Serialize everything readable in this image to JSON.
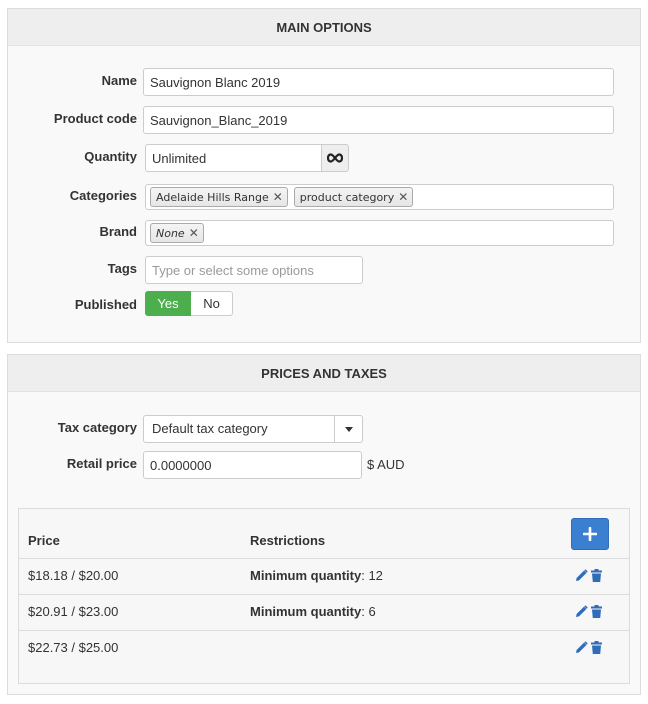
{
  "main_options": {
    "title": "MAIN OPTIONS",
    "name": {
      "label": "Name",
      "value": "Sauvignon Blanc 2019"
    },
    "product_code": {
      "label": "Product code",
      "value": "Sauvignon_Blanc_2019"
    },
    "quantity": {
      "label": "Quantity",
      "value": "Unlimited",
      "addon_icon": "infinity-icon"
    },
    "categories": {
      "label": "Categories",
      "items": [
        "Adelaide Hills Range",
        "product category"
      ]
    },
    "brand": {
      "label": "Brand",
      "value": "None"
    },
    "tags": {
      "label": "Tags",
      "placeholder": "Type or select some options"
    },
    "published": {
      "label": "Published",
      "yes_label": "Yes",
      "no_label": "No",
      "selected": "Yes"
    }
  },
  "prices_taxes": {
    "title": "PRICES AND TAXES",
    "tax_category": {
      "label": "Tax category",
      "value": "Default tax category"
    },
    "retail_price": {
      "label": "Retail price",
      "value": "0.0000000",
      "suffix": "$ AUD"
    },
    "table": {
      "headers": {
        "price": "Price",
        "restrictions": "Restrictions"
      },
      "rows": [
        {
          "price": "$18.18 / $20.00",
          "restriction_label": "Minimum quantity",
          "restriction_value": ": 12"
        },
        {
          "price": "$20.91 / $23.00",
          "restriction_label": "Minimum quantity",
          "restriction_value": ": 6"
        },
        {
          "price": "$22.73 / $25.00",
          "restriction_label": "",
          "restriction_value": ""
        }
      ]
    }
  },
  "colors": {
    "published_yes": "#4cae4c",
    "add_button": "#3a7fd0",
    "action_icons": "#2f6db8"
  }
}
